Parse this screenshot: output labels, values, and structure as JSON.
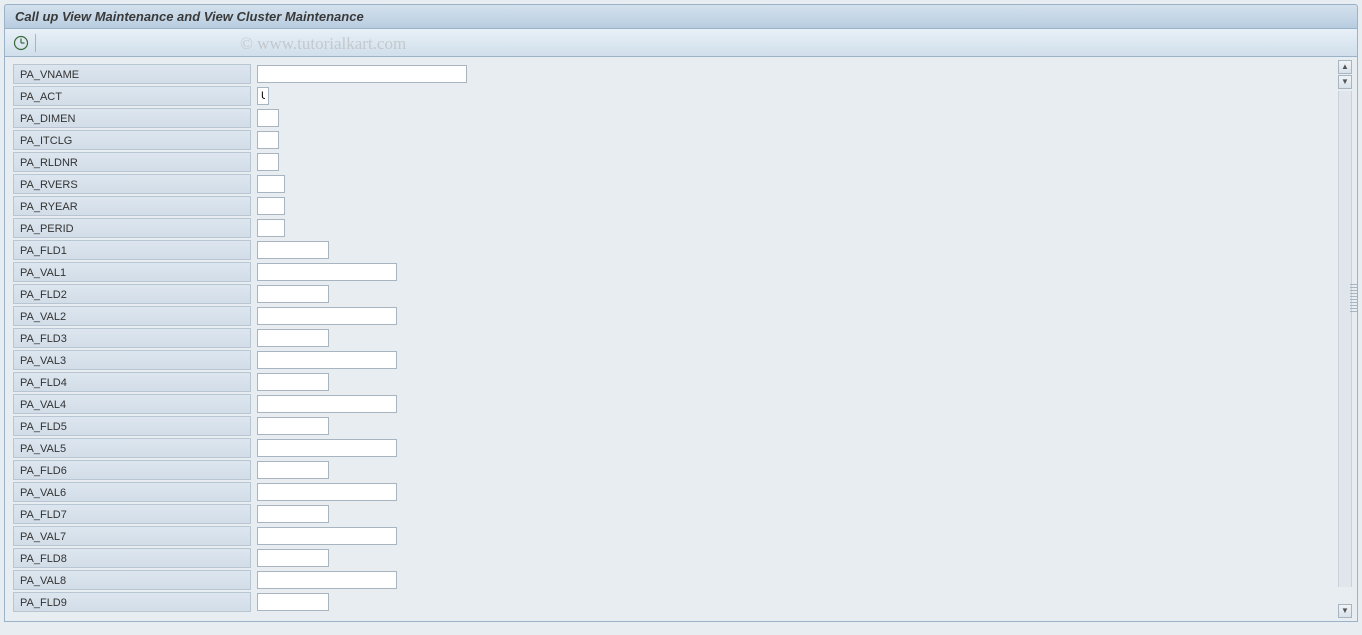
{
  "title": "Call up View Maintenance and View Cluster Maintenance",
  "watermark": "© www.tutorialkart.com",
  "toolbar": {
    "execute_icon": "execute"
  },
  "fields": [
    {
      "label": "PA_VNAME",
      "value": "",
      "width": "input-w1"
    },
    {
      "label": "PA_ACT",
      "value": "U",
      "width": "input-w2"
    },
    {
      "label": "PA_DIMEN",
      "value": "",
      "width": "input-w3"
    },
    {
      "label": "PA_ITCLG",
      "value": "",
      "width": "input-w3"
    },
    {
      "label": "PA_RLDNR",
      "value": "",
      "width": "input-w3"
    },
    {
      "label": "PA_RVERS",
      "value": "",
      "width": "input-w4"
    },
    {
      "label": "PA_RYEAR",
      "value": "",
      "width": "input-w4"
    },
    {
      "label": "PA_PERID",
      "value": "",
      "width": "input-w4"
    },
    {
      "label": "PA_FLD1",
      "value": "",
      "width": "input-w5"
    },
    {
      "label": "PA_VAL1",
      "value": "",
      "width": "input-w6"
    },
    {
      "label": "PA_FLD2",
      "value": "",
      "width": "input-w5"
    },
    {
      "label": "PA_VAL2",
      "value": "",
      "width": "input-w6"
    },
    {
      "label": "PA_FLD3",
      "value": "",
      "width": "input-w5"
    },
    {
      "label": "PA_VAL3",
      "value": "",
      "width": "input-w6"
    },
    {
      "label": "PA_FLD4",
      "value": "",
      "width": "input-w5"
    },
    {
      "label": "PA_VAL4",
      "value": "",
      "width": "input-w6"
    },
    {
      "label": "PA_FLD5",
      "value": "",
      "width": "input-w5"
    },
    {
      "label": "PA_VAL5",
      "value": "",
      "width": "input-w6"
    },
    {
      "label": "PA_FLD6",
      "value": "",
      "width": "input-w5"
    },
    {
      "label": "PA_VAL6",
      "value": "",
      "width": "input-w6"
    },
    {
      "label": "PA_FLD7",
      "value": "",
      "width": "input-w5"
    },
    {
      "label": "PA_VAL7",
      "value": "",
      "width": "input-w6"
    },
    {
      "label": "PA_FLD8",
      "value": "",
      "width": "input-w5"
    },
    {
      "label": "PA_VAL8",
      "value": "",
      "width": "input-w6"
    },
    {
      "label": "PA_FLD9",
      "value": "",
      "width": "input-w5"
    }
  ]
}
